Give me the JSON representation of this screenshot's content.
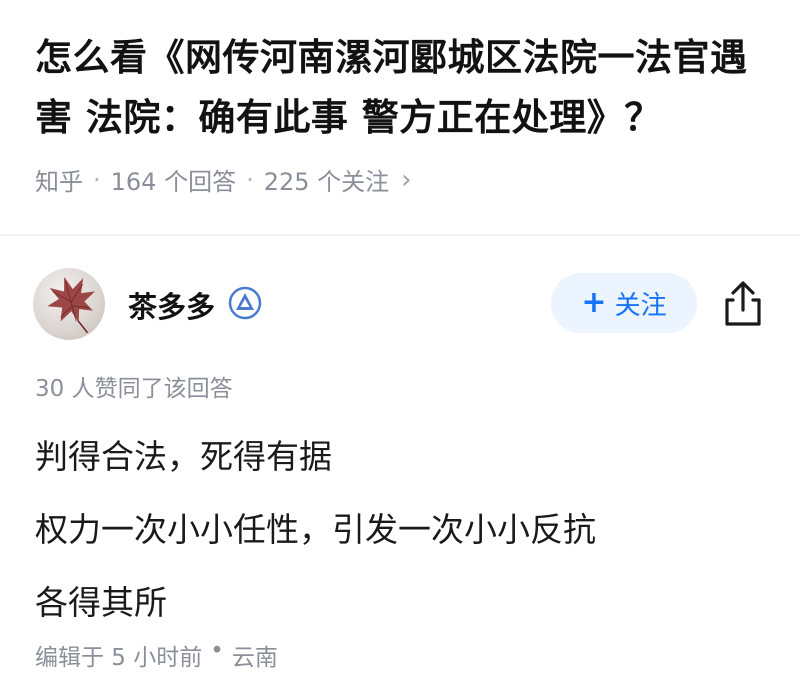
{
  "question": {
    "title": "怎么看《网传河南漯河郾城区法院一法官遇害 法院：确有此事 警方正在处理》？",
    "source": "知乎",
    "answers": "164 个回答",
    "followers": "225 个关注",
    "separator": "·",
    "chevron": "›"
  },
  "answer": {
    "author": "茶多多",
    "follow_plus": "+",
    "follow_label": "关注",
    "likes": "30 人赞同了该回答",
    "lines": [
      "判得合法，死得有据",
      "权力一次小小任性，引发一次小小反抗",
      "各得其所"
    ],
    "edited": "编辑于 5 小时前",
    "edited_sep": "•",
    "location": "云南"
  },
  "colors": {
    "accent": "#1772f6",
    "follow_bg": "#ebf4ff",
    "meta_gray": "#8a8f99",
    "badge": "#4a7bd0"
  },
  "icons": {
    "badge": "verified-badge-icon",
    "share": "share-icon",
    "chevron": "chevron-right-icon"
  }
}
